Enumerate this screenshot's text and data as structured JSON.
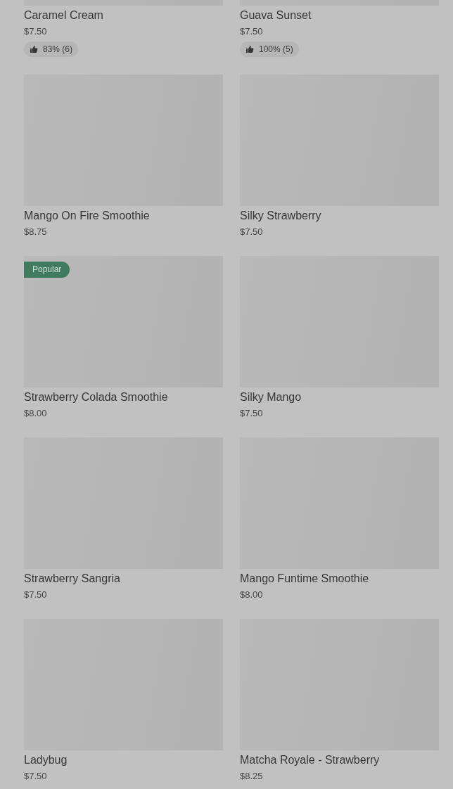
{
  "products": [
    {
      "name": "Caramel Cream",
      "price": "$7.50",
      "rating": "83% (6)"
    },
    {
      "name": "Guava Sunset",
      "price": "$7.50",
      "rating": "100% (5)"
    },
    {
      "name": "Mango On Fire Smoothie",
      "price": "$8.75"
    },
    {
      "name": "Silky Strawberry",
      "price": "$7.50"
    },
    {
      "name": "Strawberry Colada Smoothie",
      "price": "$8.00",
      "badge": "Popular"
    },
    {
      "name": "Silky Mango",
      "price": "$7.50"
    },
    {
      "name": "Strawberry Sangria",
      "price": "$7.50"
    },
    {
      "name": "Mango Funtime Smoothie",
      "price": "$8.00"
    },
    {
      "name": "Ladybug",
      "price": "$7.50"
    },
    {
      "name": "Matcha Royale - Strawberry",
      "price": "$8.25"
    }
  ]
}
